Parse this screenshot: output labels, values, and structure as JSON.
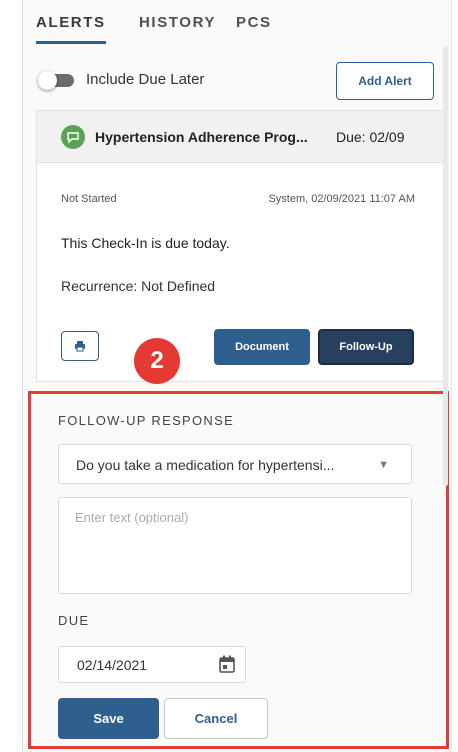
{
  "tabs": [
    {
      "label": "ALERTS",
      "active": true
    },
    {
      "label": "HISTORY",
      "active": false
    },
    {
      "label": "PCS",
      "active": false
    }
  ],
  "filters": {
    "include_due_later_label": "Include Due Later",
    "include_due_later_on": false
  },
  "add_alert_label": "Add Alert",
  "alert": {
    "program_title": "Hypertension Adherence Prog...",
    "due": "Due: 02/09",
    "status": "Not Started",
    "meta": "System, 02/09/2021 11:07 AM",
    "message": "This Check-In is due today.",
    "recurrence": "Recurrence: Not Defined",
    "document_label": "Document",
    "follow_up_label": "Follow-Up"
  },
  "step_marker": "2",
  "follow_up": {
    "title": "FOLLOW-UP RESPONSE",
    "selected_question": "Do you take a medication for hypertensi...",
    "text_placeholder": "Enter text (optional)",
    "due_label": "DUE",
    "due_date": "02/14/2021",
    "save_label": "Save",
    "cancel_label": "Cancel"
  },
  "colors": {
    "primary": "#2f5f8f",
    "highlight": "#e23b3b",
    "badge": "#e53a33",
    "program_icon": "#5aa356"
  }
}
